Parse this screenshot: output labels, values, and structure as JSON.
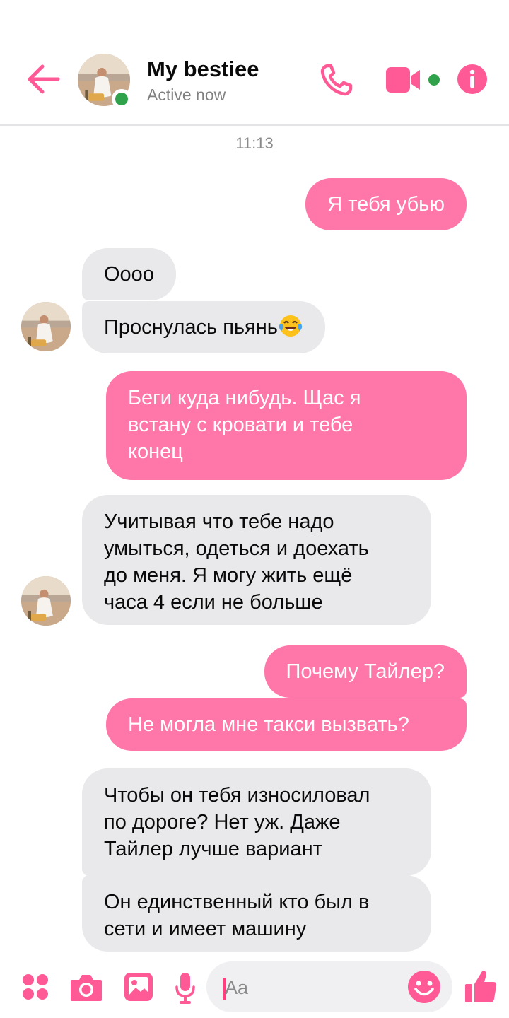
{
  "header": {
    "contact_name": "My bestiee",
    "status": "Active now"
  },
  "chat": {
    "timestamp": "11:13",
    "messages": [
      {
        "direction": "outgoing",
        "text": "Я тебя убью"
      },
      {
        "direction": "incoming",
        "text": "Оооо"
      },
      {
        "direction": "incoming",
        "text": "Проснулась пьянь",
        "emoji": "face-with-tears-of-joy"
      },
      {
        "direction": "outgoing",
        "lines": [
          "Беги куда нибудь. Щас я",
          "встану с кровати и тебе",
          "конец"
        ]
      },
      {
        "direction": "incoming",
        "lines": [
          "Учитывая что тебе надо",
          "умыться, одеться и доехать",
          "до меня. Я могу жить ещё",
          "часа 4 если не больше"
        ]
      },
      {
        "direction": "outgoing",
        "text": "Почему Тайлер?"
      },
      {
        "direction": "outgoing",
        "text": "Не могла мне такси вызвать?"
      },
      {
        "direction": "incoming",
        "lines": [
          "Чтобы он тебя износиловал",
          "по дороге? Нет уж. Даже",
          "Тайлер лучше вариант"
        ]
      },
      {
        "direction": "incoming",
        "lines": [
          "Он единственный кто был в",
          "сети и имеет машину"
        ]
      }
    ]
  },
  "composer": {
    "placeholder": "Aa",
    "icons": [
      "apps-icon",
      "camera-icon",
      "gallery-icon",
      "microphone-icon",
      "emoji-icon",
      "thumbs-up-icon"
    ]
  },
  "colors": {
    "accent": "#ff77a8",
    "icon_pink": "#ff5a96",
    "incoming_bubble": "#e9e9eb",
    "online": "#31a24c"
  }
}
